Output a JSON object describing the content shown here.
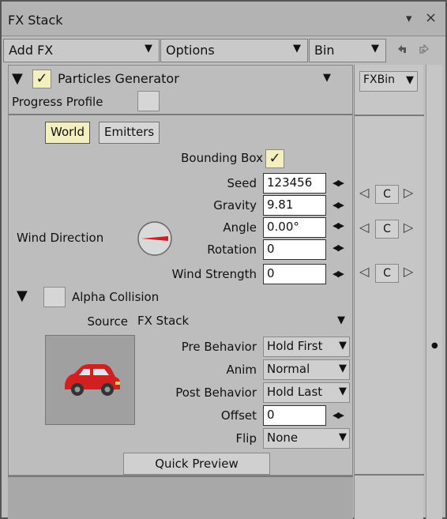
{
  "window": {
    "title": "FX Stack",
    "minimize_icon": "▾",
    "close_icon": "×"
  },
  "menubar": {
    "add_fx": "Add FX",
    "options": "Options",
    "bin": "Bin",
    "undo_icon": "undo-icon",
    "redo_icon": "redo-icon"
  },
  "effect": {
    "name": "Particles Generator",
    "progress_profile": "Progress Profile",
    "fxbin": "FXBin"
  },
  "tabs": {
    "world": "World",
    "emitters": "Emitters"
  },
  "params": {
    "bounding_box": "Bounding Box",
    "seed_label": "Seed",
    "seed_value": "123456",
    "gravity_label": "Gravity",
    "gravity_value": "9.81",
    "angle_label": "Angle",
    "angle_value": "0.00°",
    "rotation_label": "Rotation",
    "rotation_value": "0",
    "wind_strength_label": "Wind Strength",
    "wind_strength_value": "0",
    "wind_direction_label": "Wind Direction",
    "c_label": "C"
  },
  "alpha": {
    "label": "Alpha Collision",
    "source_label": "Source",
    "source_value": "FX Stack",
    "pre_behavior_label": "Pre Behavior",
    "pre_behavior_value": "Hold First",
    "anim_label": "Anim",
    "anim_value": "Normal",
    "post_behavior_label": "Post Behavior",
    "post_behavior_value": "Hold Last",
    "offset_label": "Offset",
    "offset_value": "0",
    "flip_label": "Flip",
    "flip_value": "None",
    "quick_preview": "Quick Preview"
  },
  "colors": {
    "accent_red": "#d21f1f",
    "field_yellow": "#f3efbf",
    "panel_grey": "#bdbdbd"
  }
}
